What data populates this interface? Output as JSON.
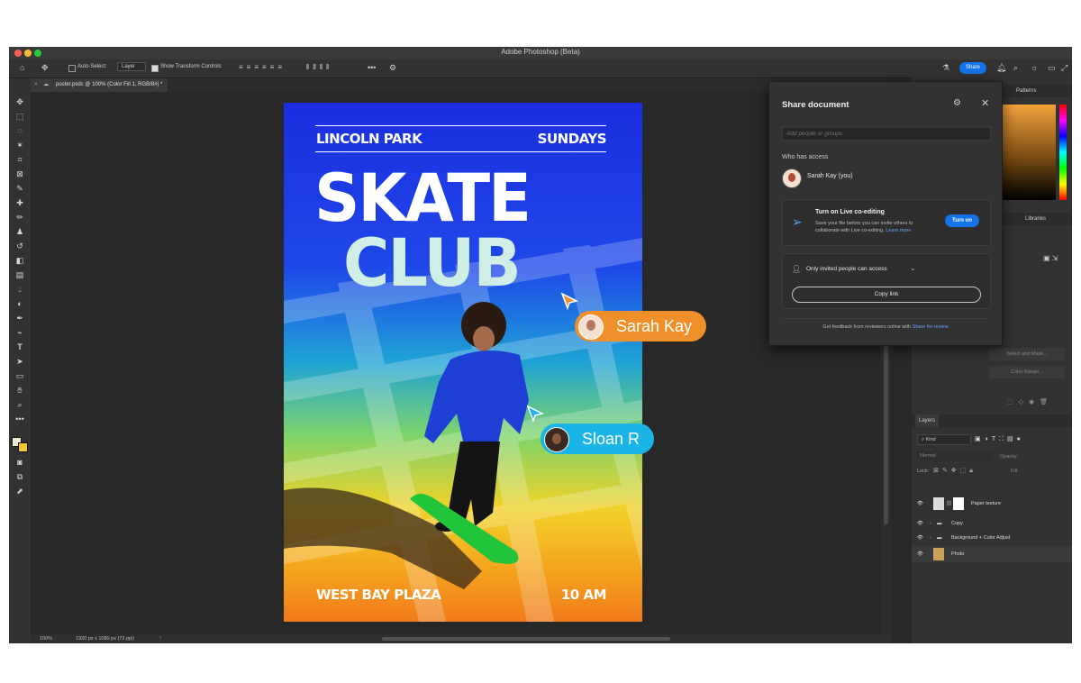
{
  "window": {
    "title": "Adobe Photoshop (Beta)"
  },
  "options_bar": {
    "auto_select_label": "Auto-Select:",
    "auto_select_value": "Layer",
    "transform_controls_label": "Show Transform Controls",
    "share_button": "Share"
  },
  "document_tab": {
    "label": "poster.psdc @ 100% (Color Fill 1, RGB/8#) *"
  },
  "status_bar": {
    "zoom": "100%",
    "doc_info": "1920 px x 1080 px (72 ppi)"
  },
  "poster": {
    "top_left": "LINCOLN PARK",
    "top_right": "SUNDAYS",
    "title_line1": "SKATE",
    "title_line2": "CLUB",
    "bottom_left": "WEST BAY PLAZA",
    "bottom_right": "10 AM"
  },
  "collaborators": [
    {
      "name": "Sarah Kay",
      "color": "#f0902a"
    },
    {
      "name": "Sloan R",
      "color": "#1bb4e6"
    }
  ],
  "share_panel": {
    "title": "Share document",
    "add_placeholder": "Add people or groups",
    "who_has_access": "Who has access",
    "user": "Sarah Kay (you)",
    "live_title": "Turn on Live co-editing",
    "live_desc": "Save your file before you can invite others to collaborate with Live co-editing.",
    "learn_more": "Learn more",
    "turn_on": "Turn on",
    "access_level": "Only invited people can access",
    "copy_link": "Copy link",
    "feedback_text": "Get feedback from reviewers online with",
    "feedback_link": "Share for review"
  },
  "right_panel": {
    "tabs": [
      "Patterns"
    ],
    "libraries": "Libraries",
    "select_and_mask": "Select and Mask...",
    "color_range": "Color Range...",
    "layers_tab": "Layers",
    "kind_filter": "Kind",
    "blend_mode": "Normal",
    "opacity_label": "Opacity:",
    "lock_label": "Lock:",
    "fill_label": "Fill:",
    "layers": [
      "Paper texture",
      "Copy",
      "Background + Color Adjust",
      "Photo"
    ]
  },
  "colors": {
    "accent": "#1473e6",
    "app_bg": "#282828",
    "panel_bg": "#323232"
  }
}
